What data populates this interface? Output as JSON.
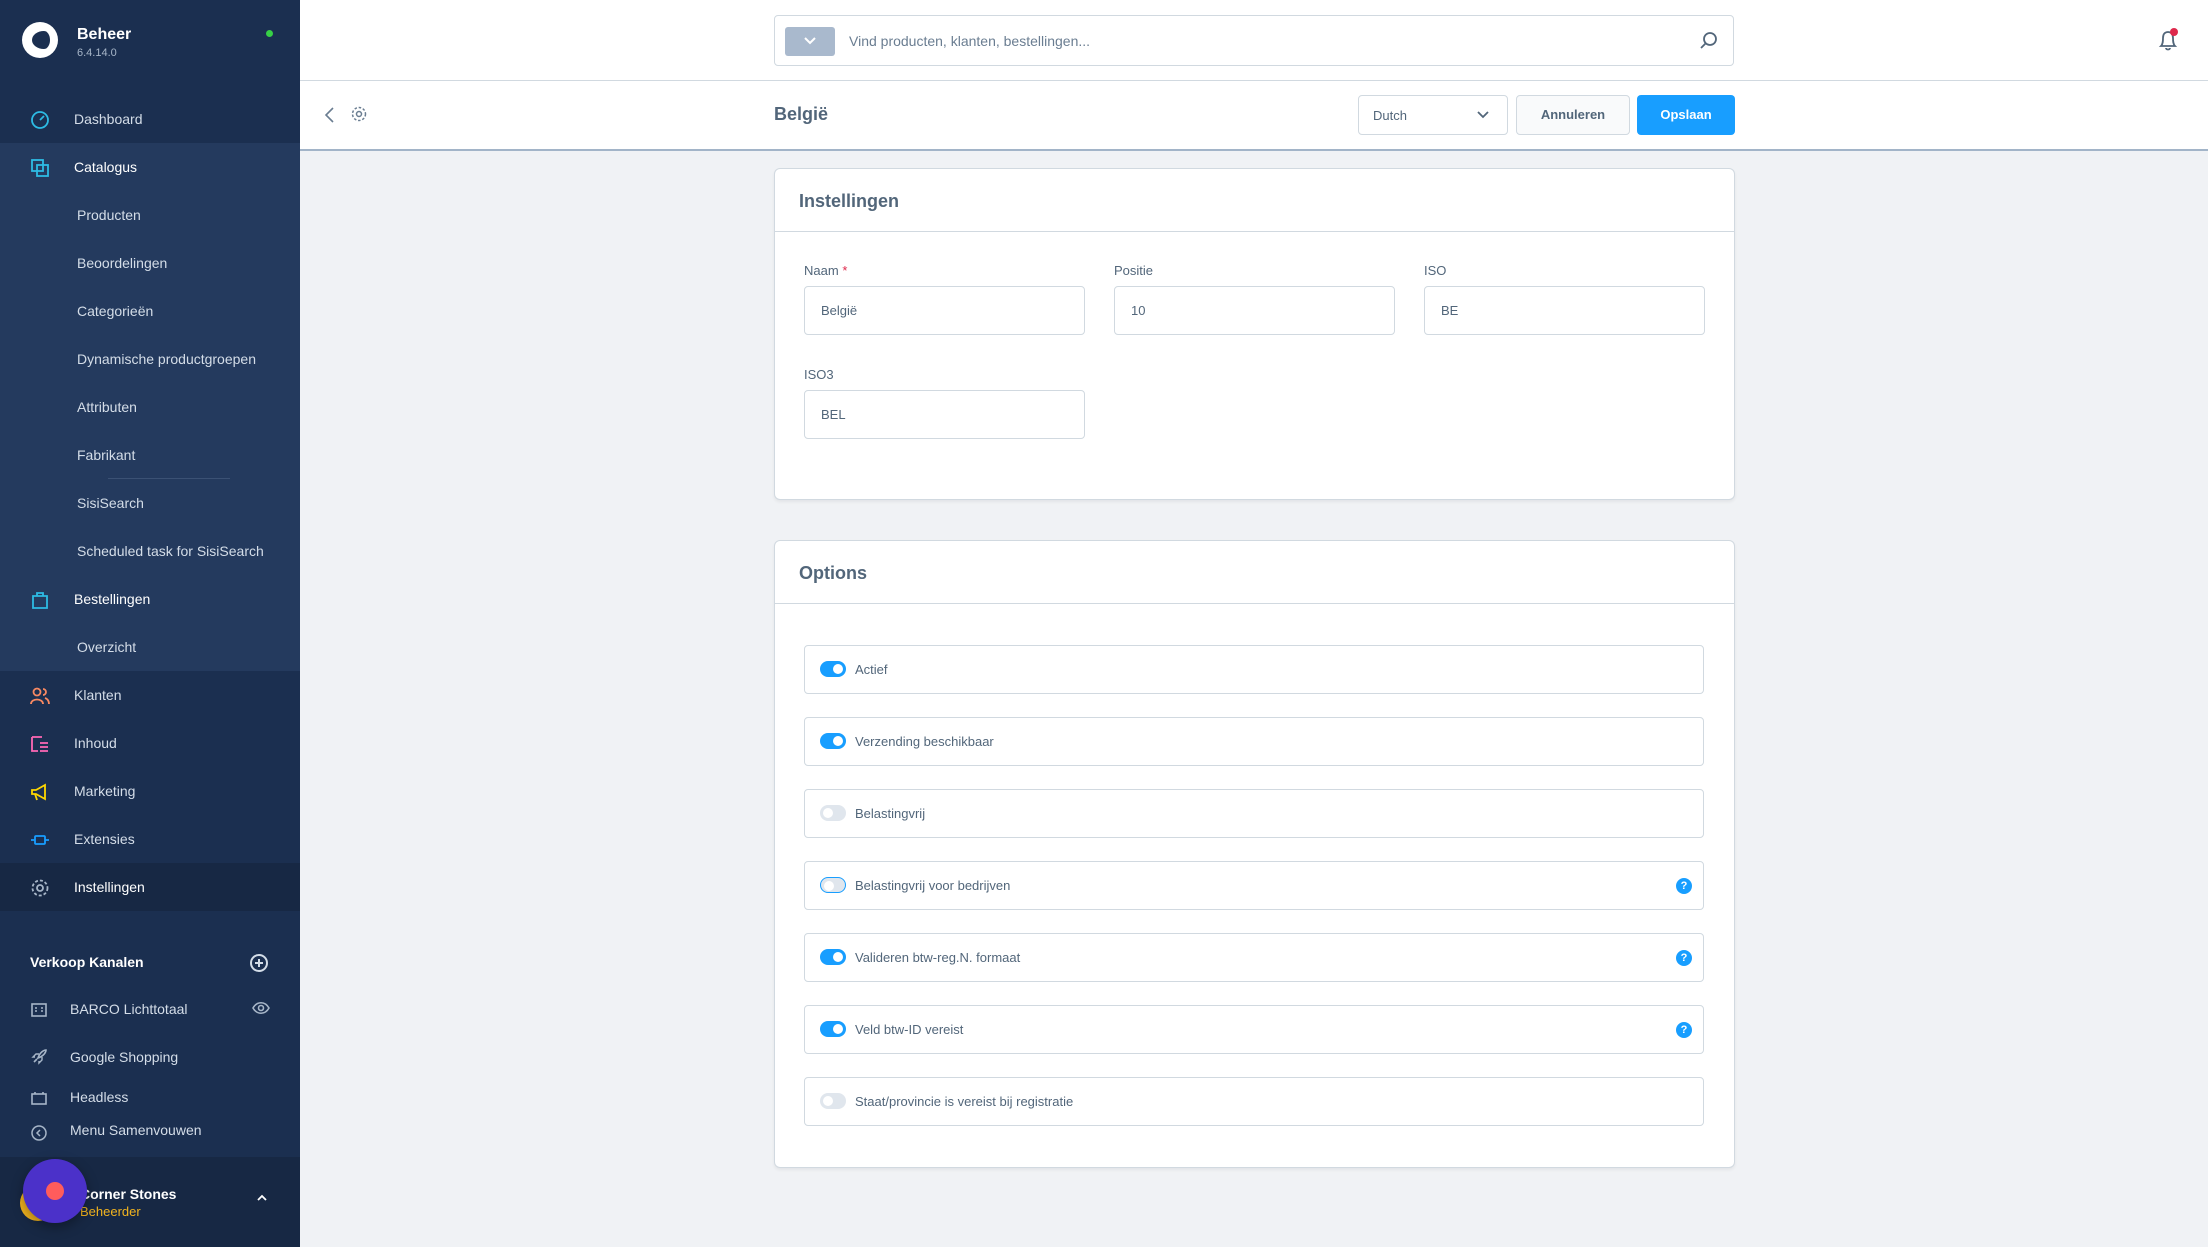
{
  "app": {
    "title": "Beheer",
    "version": "6.4.14.0"
  },
  "sidebar": {
    "items": [
      {
        "label": "Dashboard",
        "icon": "dashboard-icon"
      },
      {
        "label": "Catalogus",
        "icon": "catalog-icon"
      },
      {
        "label": "Bestellingen",
        "icon": "orders-icon"
      },
      {
        "label": "Klanten",
        "icon": "customers-icon"
      },
      {
        "label": "Inhoud",
        "icon": "content-icon"
      },
      {
        "label": "Marketing",
        "icon": "marketing-icon"
      },
      {
        "label": "Extensies",
        "icon": "extensions-icon"
      },
      {
        "label": "Instellingen",
        "icon": "settings-icon"
      }
    ],
    "catalog_children": [
      "Producten",
      "Beoordelingen",
      "Categorieën",
      "Dynamische productgroepen",
      "Attributen",
      "Fabrikant",
      "SisiSearch",
      "Scheduled task for SisiSearch"
    ],
    "order_children": [
      "Overzicht"
    ],
    "sales_channels_title": "Verkoop Kanalen",
    "sales_channels": [
      {
        "label": "BARCO Lichttotaal",
        "icon": "storefront-icon"
      },
      {
        "label": "Google Shopping",
        "icon": "rocket-icon"
      },
      {
        "label": "Headless",
        "icon": "headless-icon"
      }
    ],
    "collapse_label": "Menu Samenvouwen",
    "user": {
      "name": "Corner Stones",
      "role": "Beheerder"
    }
  },
  "search": {
    "placeholder": "Vind producten, klanten, bestellingen..."
  },
  "smartbar": {
    "title": "België",
    "language": "Dutch",
    "cancel_label": "Annuleren",
    "save_label": "Opslaan"
  },
  "settings_card": {
    "title": "Instellingen",
    "name_label": "Naam",
    "name_required": "*",
    "name_value": "België",
    "position_label": "Positie",
    "position_value": "10",
    "iso_label": "ISO",
    "iso_value": "BE",
    "iso3_label": "ISO3",
    "iso3_value": "BEL"
  },
  "options_card": {
    "title": "Options",
    "options": [
      {
        "label": "Actief",
        "on": true,
        "help": false
      },
      {
        "label": "Verzending beschikbaar",
        "on": true,
        "help": false
      },
      {
        "label": "Belastingvrij",
        "on": false,
        "help": false
      },
      {
        "label": "Belastingvrij voor bedrijven",
        "on": false,
        "help": true
      },
      {
        "label": "Valideren btw-reg.N. formaat",
        "on": true,
        "help": true
      },
      {
        "label": "Veld btw-ID vereist",
        "on": true,
        "help": true
      },
      {
        "label": "Staat/provincie is vereist bij registratie",
        "on": false,
        "help": false
      }
    ],
    "help_glyph": "?"
  },
  "colors": {
    "sidebar_bg": "#1b2f50",
    "primary": "#189eff",
    "status_online": "#37d046",
    "required": "#de294c"
  }
}
